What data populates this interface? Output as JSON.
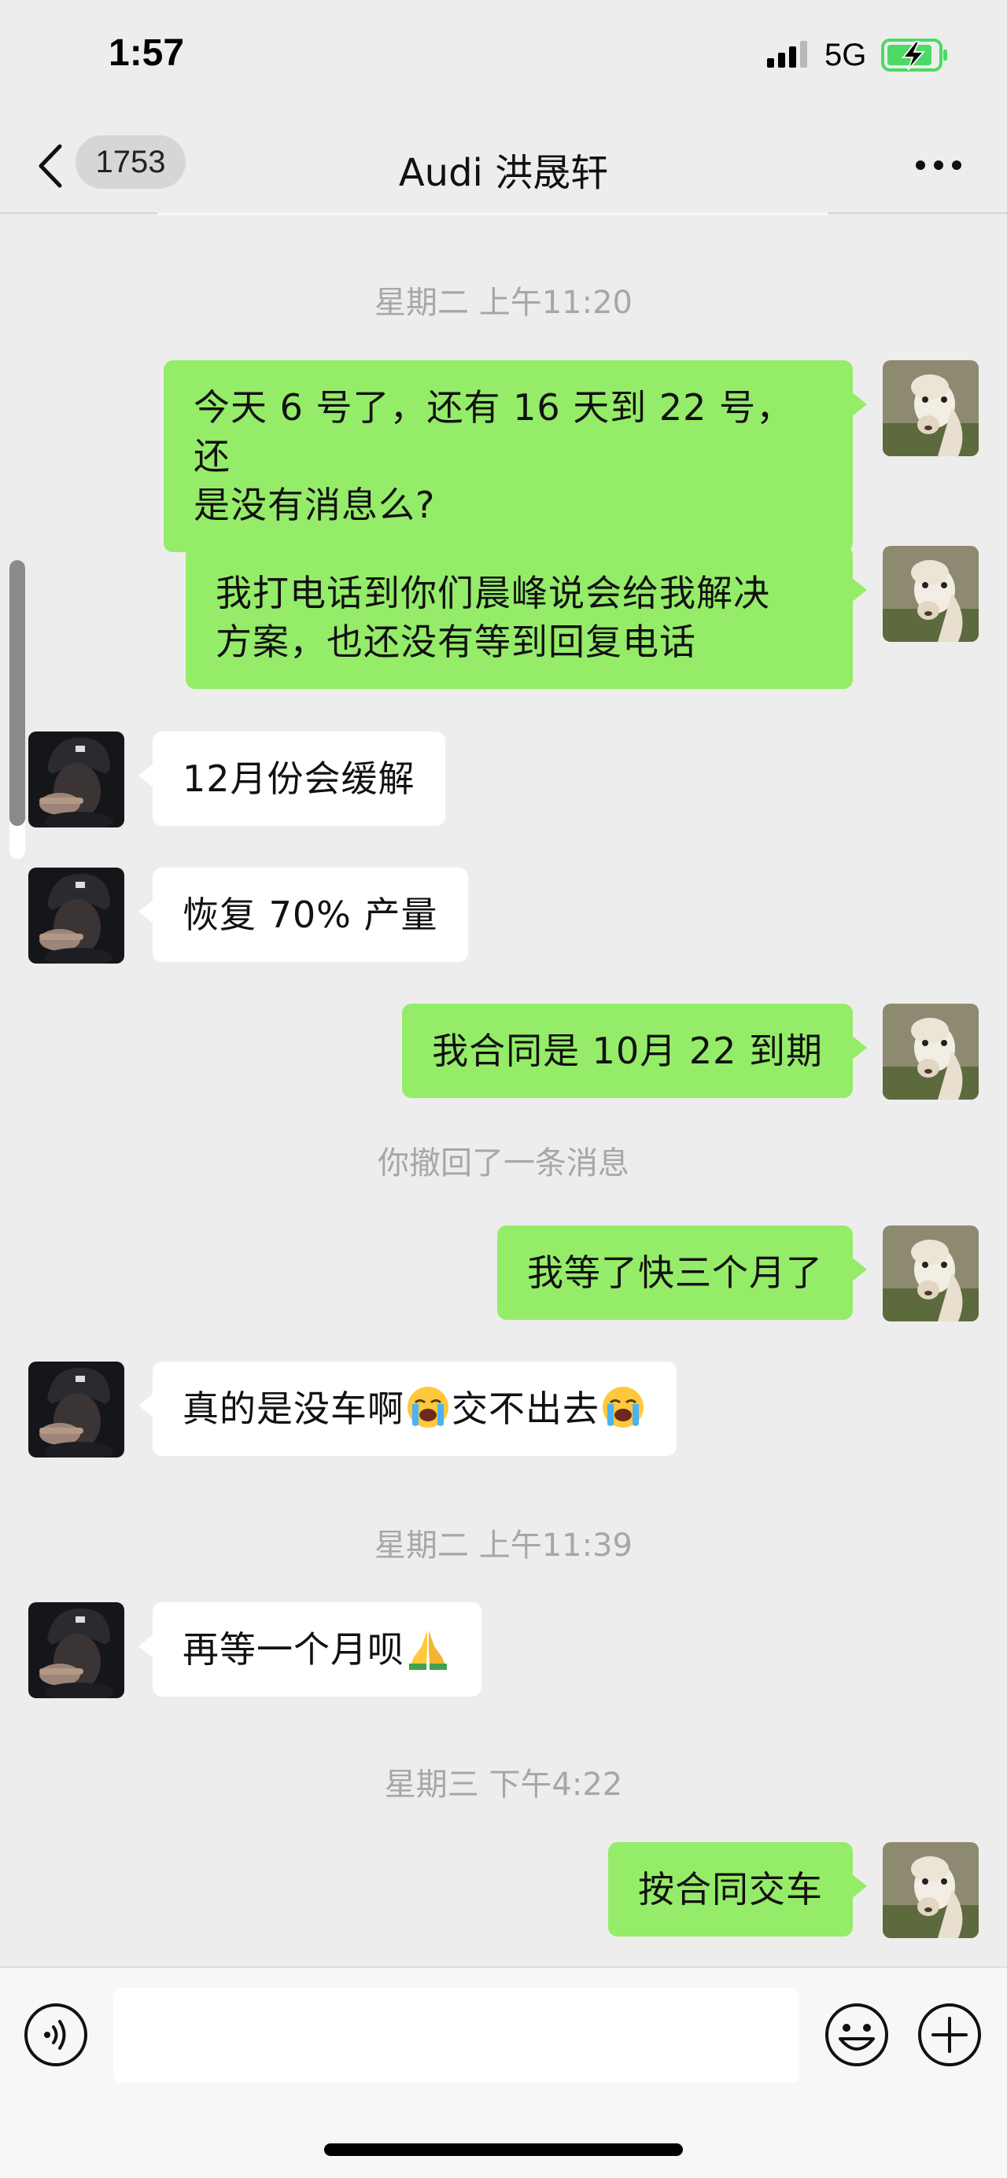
{
  "status": {
    "time": "1:57",
    "network": "5G"
  },
  "nav": {
    "unread_count": "1753",
    "title": "Audi 洪晟轩"
  },
  "messages": {
    "ts1": "星期二 上午11:20",
    "m1_line1": "今天 6 号了，还有 16 天到 22 号，还",
    "m1_line2": "是没有消息么?",
    "m2_line1": "我打电话到你们晨峰说会给我解决",
    "m2_line2": "方案，也还没有等到回复电话",
    "m3": "12月份会缓解",
    "m4": "恢复 70% 产量",
    "m5": "我合同是 10月 22 到期",
    "recalled": "你撤回了一条消息",
    "m6": "我等了快三个月了",
    "m7_a": "真的是没车啊",
    "m7_b": "交不出去",
    "ts2": "星期二 上午11:39",
    "m8": "再等一个月呗",
    "ts3": "星期三 下午4:22",
    "m9": "按合同交车"
  },
  "input": {
    "value": ""
  },
  "colors": {
    "me_bubble": "#95ec69",
    "them_bubble": "#ffffff",
    "background": "#ededed"
  },
  "icons": {
    "voice": "voice-icon",
    "emoji": "smiley-icon",
    "plus": "plus-icon",
    "back": "chevron-left-icon",
    "more": "more-dots-icon",
    "crying": "loudly-crying-emoji",
    "pray": "folded-hands-emoji"
  }
}
